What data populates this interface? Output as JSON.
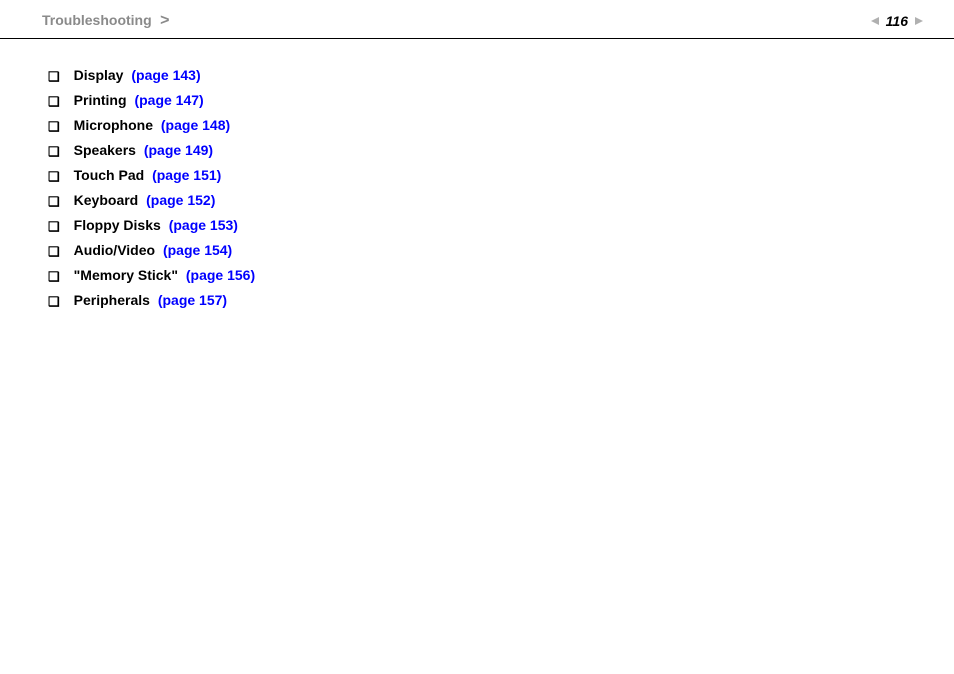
{
  "header": {
    "breadcrumb": "Troubleshooting",
    "sep": ">",
    "page_number": "116"
  },
  "items": [
    {
      "label": "Display",
      "link": "(page 143)"
    },
    {
      "label": "Printing",
      "link": "(page 147)"
    },
    {
      "label": "Microphone",
      "link": "(page 148)"
    },
    {
      "label": "Speakers",
      "link": "(page 149)"
    },
    {
      "label": "Touch Pad",
      "link": "(page 151)"
    },
    {
      "label": "Keyboard",
      "link": "(page 152)"
    },
    {
      "label": "Floppy Disks",
      "link": "(page 153)"
    },
    {
      "label": "Audio/Video",
      "link": "(page 154)"
    },
    {
      "label": "\"Memory Stick\"",
      "link": "(page 156)"
    },
    {
      "label": "Peripherals",
      "link": "(page 157)"
    }
  ]
}
